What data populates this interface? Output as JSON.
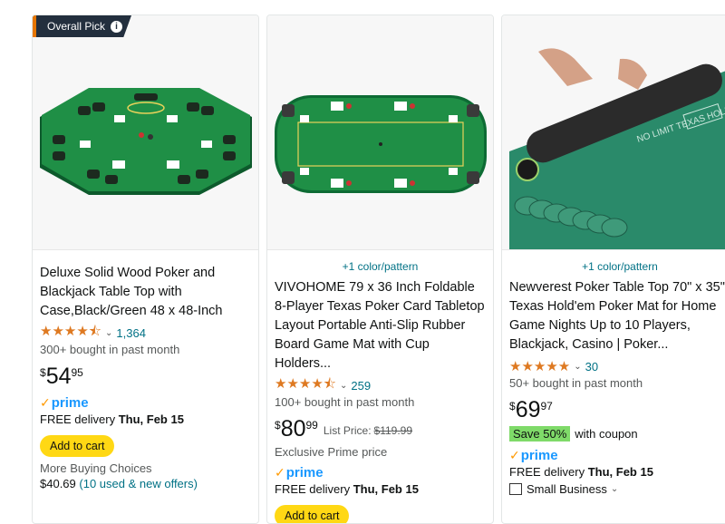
{
  "cards": [
    {
      "badge": "Overall Pick",
      "title": "Deluxe Solid Wood Poker and Blackjack Table Top with Case,Black/Green 48 x 48-Inch",
      "rating_stars": "★★★★⯪",
      "rating_value": 4.5,
      "rating_count": "1,364",
      "bought": "300+ bought in past month",
      "price_symbol": "$",
      "price_whole": "54",
      "price_fraction": "95",
      "prime": "prime",
      "delivery_prefix": "FREE delivery ",
      "delivery_date": "Thu, Feb 15",
      "button": "Add to cart",
      "more_buying": "More Buying Choices",
      "more_price": "$40.69",
      "more_offers": "(10 used & new offers)"
    },
    {
      "color_link": "+1 color/pattern",
      "title": "VIVOHOME 79 x 36 Inch Foldable 8-Player Texas Poker Card Tabletop Layout Portable Anti-Slip Rubber Board Game Mat with Cup Holders...",
      "rating_stars": "★★★★⯪",
      "rating_value": 4.5,
      "rating_count": "259",
      "bought": "100+ bought in past month",
      "price_symbol": "$",
      "price_whole": "80",
      "price_fraction": "99",
      "list_label": "List Price:",
      "list_price": "$119.99",
      "exclusive": "Exclusive Prime price",
      "prime": "prime",
      "delivery_prefix": "FREE delivery ",
      "delivery_date": "Thu, Feb 15",
      "button": "Add to cart"
    },
    {
      "color_link": "+1 color/pattern",
      "title": "Newverest Poker Table Top 70\" x 35\", Texas Hold'em Poker Mat for Home Game Nights Up to 10 Players, Blackjack, Casino | Poker...",
      "rating_stars": "★★★★★",
      "rating_value": 4.8,
      "rating_count": "30",
      "bought": "50+ bought in past month",
      "price_symbol": "$",
      "price_whole": "69",
      "price_fraction": "97",
      "coupon_badge": "Save 50%",
      "coupon_text": "with coupon",
      "prime": "prime",
      "delivery_prefix": "FREE delivery ",
      "delivery_date": "Thu, Feb 15",
      "small_business": "Small Business",
      "mat_text": "NO LIMIT TEXAS HOLD'EM"
    }
  ],
  "colors": {
    "felt": "#1f8f46",
    "felt_dark": "#0d6b34",
    "mat_green": "#2a8a6a",
    "accent_orange": "#e77600",
    "button_yellow": "#ffd814",
    "link": "#007185",
    "prime_blue": "#1a98ff",
    "star": "#de7921",
    "save_green": "#7fda69"
  }
}
